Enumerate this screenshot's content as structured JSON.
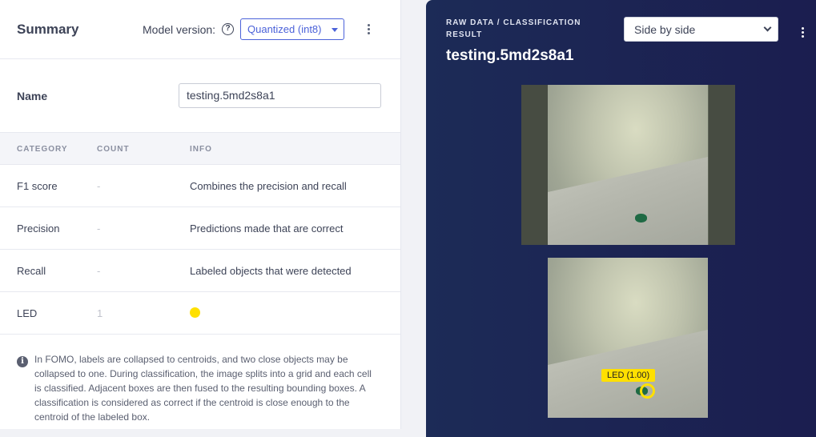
{
  "summary": {
    "title": "Summary",
    "model_version_label": "Model version:",
    "model_version_value": "Quantized (int8)"
  },
  "name": {
    "label": "Name",
    "value": "testing.5md2s8a1"
  },
  "table": {
    "headers": [
      "CATEGORY",
      "COUNT",
      "INFO"
    ],
    "rows": [
      {
        "category": "F1 score",
        "count": "-",
        "info": "Combines the precision and recall"
      },
      {
        "category": "Precision",
        "count": "-",
        "info": "Predictions made that are correct"
      },
      {
        "category": "Recall",
        "count": "-",
        "info": "Labeled objects that were detected"
      },
      {
        "category": "LED",
        "count": "1",
        "info_color": "#ffe000"
      }
    ]
  },
  "note": {
    "text": "In FOMO, labels are collapsed to centroids, and two close objects may be collapsed to one. During classification, the image splits into a grid and each cell is classified. Adjacent boxes are then fused to the resulting bounding boxes. A classification is considered as correct if the centroid is close enough to the centroid of the labeled box."
  },
  "raw_data": {
    "label": "RAW DATA / CLASSIFICATION RESULT",
    "title": "testing.5md2s8a1",
    "view_mode": "Side by side",
    "detection_label": "LED (1.00)"
  },
  "colors": {
    "accent": "#4b62d9",
    "panel": "#1c2b57",
    "detection": "#ffe000"
  }
}
